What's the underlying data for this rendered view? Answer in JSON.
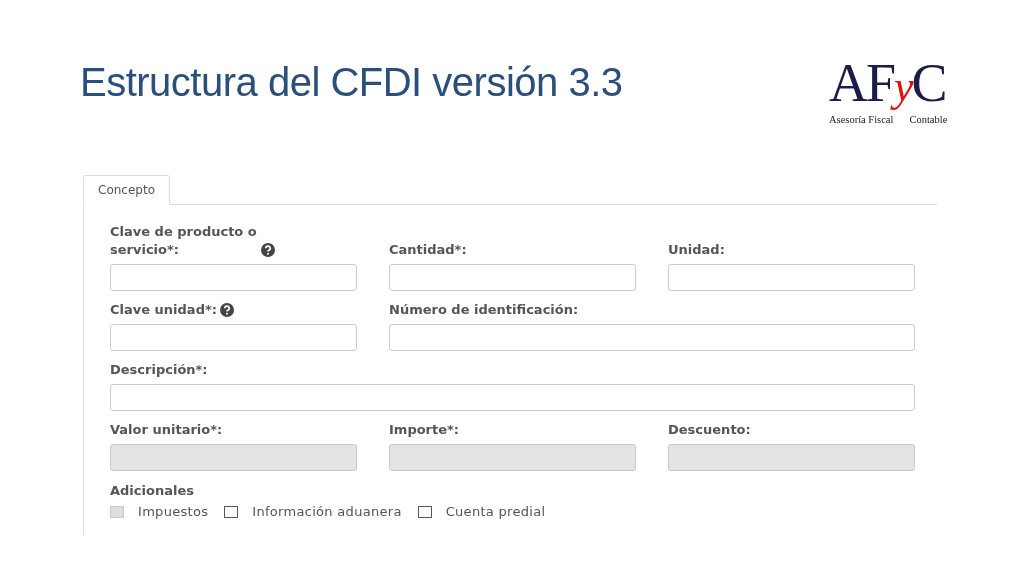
{
  "slide": {
    "title": "Estructura del CFDI versión 3.3"
  },
  "logo": {
    "mark_parts": [
      {
        "text": "AF",
        "accent": false
      },
      {
        "text": "y",
        "accent": true
      },
      {
        "text": "C",
        "accent": false
      }
    ],
    "tagline": [
      "Asesoría Fiscal",
      "Contable"
    ]
  },
  "tabs": [
    {
      "label": "Concepto",
      "selected": true
    }
  ],
  "fields": [
    {
      "label": "Clave de producto o servicio*:",
      "help": true,
      "disabled": false,
      "kind": "narrow"
    },
    {
      "label": "Cantidad*:",
      "help": false,
      "disabled": false,
      "kind": "narrow"
    },
    {
      "label": "Unidad:",
      "help": false,
      "disabled": false,
      "kind": "narrow"
    },
    {
      "label": "Clave unidad*:",
      "help": true,
      "disabled": false,
      "kind": "narrow"
    },
    {
      "label": "Número de identificación:",
      "help": false,
      "disabled": false,
      "kind": "wide"
    },
    {
      "label": "Descripción*:",
      "help": false,
      "disabled": false,
      "kind": "full"
    },
    {
      "label": "Valor unitario*:",
      "help": false,
      "disabled": true,
      "kind": "narrow"
    },
    {
      "label": "Importe*:",
      "help": false,
      "disabled": true,
      "kind": "narrow"
    },
    {
      "label": "Descuento:",
      "help": false,
      "disabled": true,
      "kind": "narrow"
    }
  ],
  "additional": {
    "heading": "Adicionales",
    "options": [
      {
        "label": "Impuestos",
        "checked": false,
        "disabled": true
      },
      {
        "label": "Información aduanera",
        "checked": false,
        "disabled": false
      },
      {
        "label": "Cuenta predial",
        "checked": false,
        "disabled": false
      }
    ]
  }
}
